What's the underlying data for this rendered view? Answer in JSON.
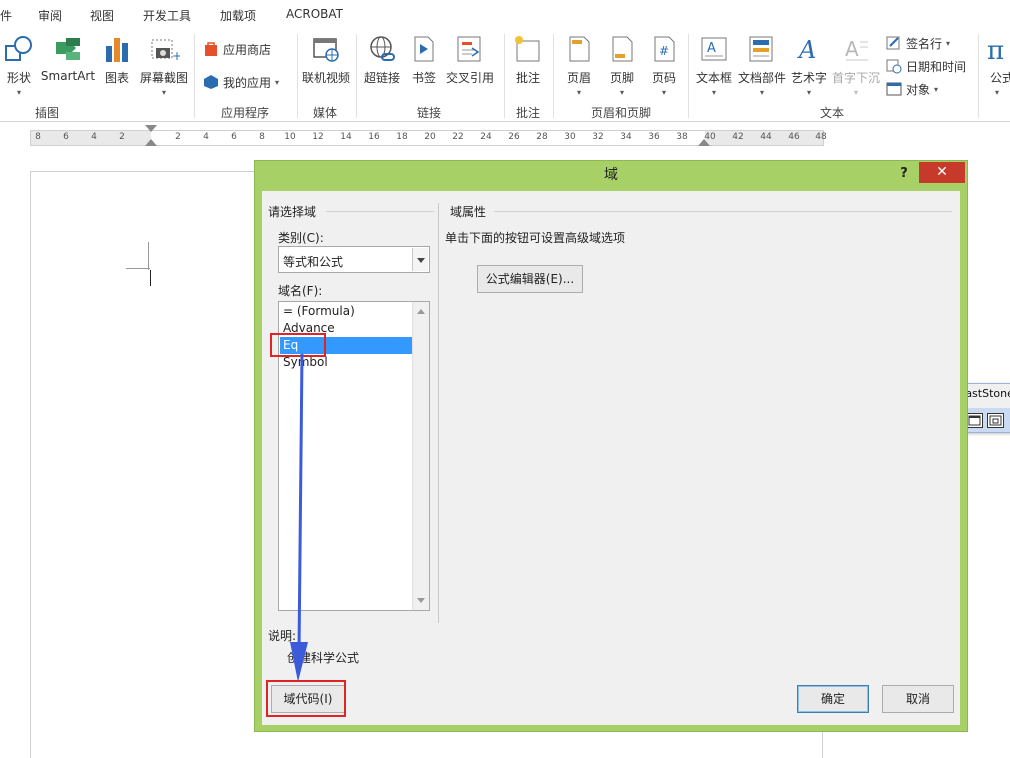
{
  "menu": {
    "tabs": [
      "件",
      "审阅",
      "视图",
      "开发工具",
      "加载项",
      "ACROBAT"
    ]
  },
  "ribbon": {
    "illustrations": {
      "label": "插图",
      "shapes": "形状",
      "smartart": "SmartArt",
      "chart": "图表",
      "screenshot": "屏幕截图"
    },
    "apps": {
      "label": "应用程序",
      "store": "应用商店",
      "my_apps": "我的应用"
    },
    "media": {
      "label": "媒体",
      "online_video": "联机视频"
    },
    "links": {
      "label": "链接",
      "hyperlink": "超链接",
      "bookmark": "书签",
      "cross_reference": "交叉引用"
    },
    "comments": {
      "label": "批注",
      "comment": "批注"
    },
    "header_footer": {
      "label": "页眉和页脚",
      "header": "页眉",
      "footer": "页脚",
      "page_number": "页码"
    },
    "text": {
      "label": "文本",
      "textbox": "文本框",
      "quick_parts": "文档部件",
      "wordart": "艺术字",
      "drop_cap": "首字下沉",
      "signature_line": "签名行",
      "date_time": "日期和时间",
      "object": "对象"
    },
    "symbols": {
      "equation": "公式"
    }
  },
  "ruler": {
    "left_numbers": [
      "8",
      "6",
      "4",
      "2"
    ],
    "right_numbers": [
      "2",
      "4",
      "6",
      "8",
      "10",
      "12",
      "14",
      "16",
      "18",
      "20",
      "22",
      "24",
      "26",
      "28",
      "30",
      "32",
      "34",
      "36",
      "38",
      "40",
      "42",
      "44",
      "46",
      "48"
    ]
  },
  "dialog": {
    "title": "域",
    "help": "?",
    "close": "✕",
    "choose_field": "请选择域",
    "category_label": "类别(C):",
    "category_value": "等式和公式",
    "field_names_label": "域名(F):",
    "field_names": [
      "= (Formula)",
      "Advance",
      "Eq",
      "Symbol"
    ],
    "selected_index": 2,
    "field_properties": "域属性",
    "properties_hint": "单击下面的按钮可设置高级域选项",
    "formula_editor_button": "公式编辑器(E)...",
    "description_label": "说明:",
    "description_text": "创建科学公式",
    "field_codes_button": "域代码(I)",
    "ok_button": "确定",
    "cancel_button": "取消"
  },
  "faststone": {
    "title": "FastStone"
  },
  "colors": {
    "dialog_frame": "#a7d166",
    "selection": "#3399ff",
    "highlight": "#e02424",
    "annotation_arrow": "#3b5bdb",
    "close_button": "#c7392b"
  }
}
